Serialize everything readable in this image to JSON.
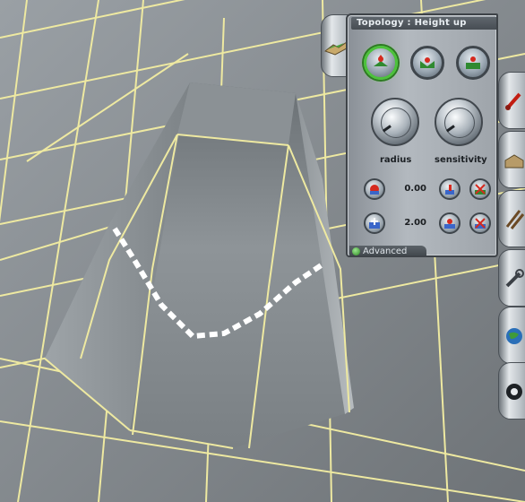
{
  "panel": {
    "title": "Topology : Height up",
    "knob_radius_label": "radius",
    "knob_sensitivity_label": "sensitivity",
    "row1_value": "0.00",
    "row2_value": "2.00",
    "advanced_label": "Advanced"
  },
  "icons": {
    "mode_buttons": [
      "height-up-icon",
      "height-down-icon",
      "plateau-icon"
    ],
    "side_tabs": [
      "topology-tab-icon",
      "paint-brush-icon",
      "building-icon",
      "railway-track-icon",
      "wrench-icon",
      "globe-icon",
      "settings-wheel-icon"
    ]
  },
  "colors": {
    "panel_bg": "#a6adb3",
    "active_highlight": "#4cc23b",
    "grid_line": "#f2eda0",
    "terrain": "#7d8286"
  }
}
